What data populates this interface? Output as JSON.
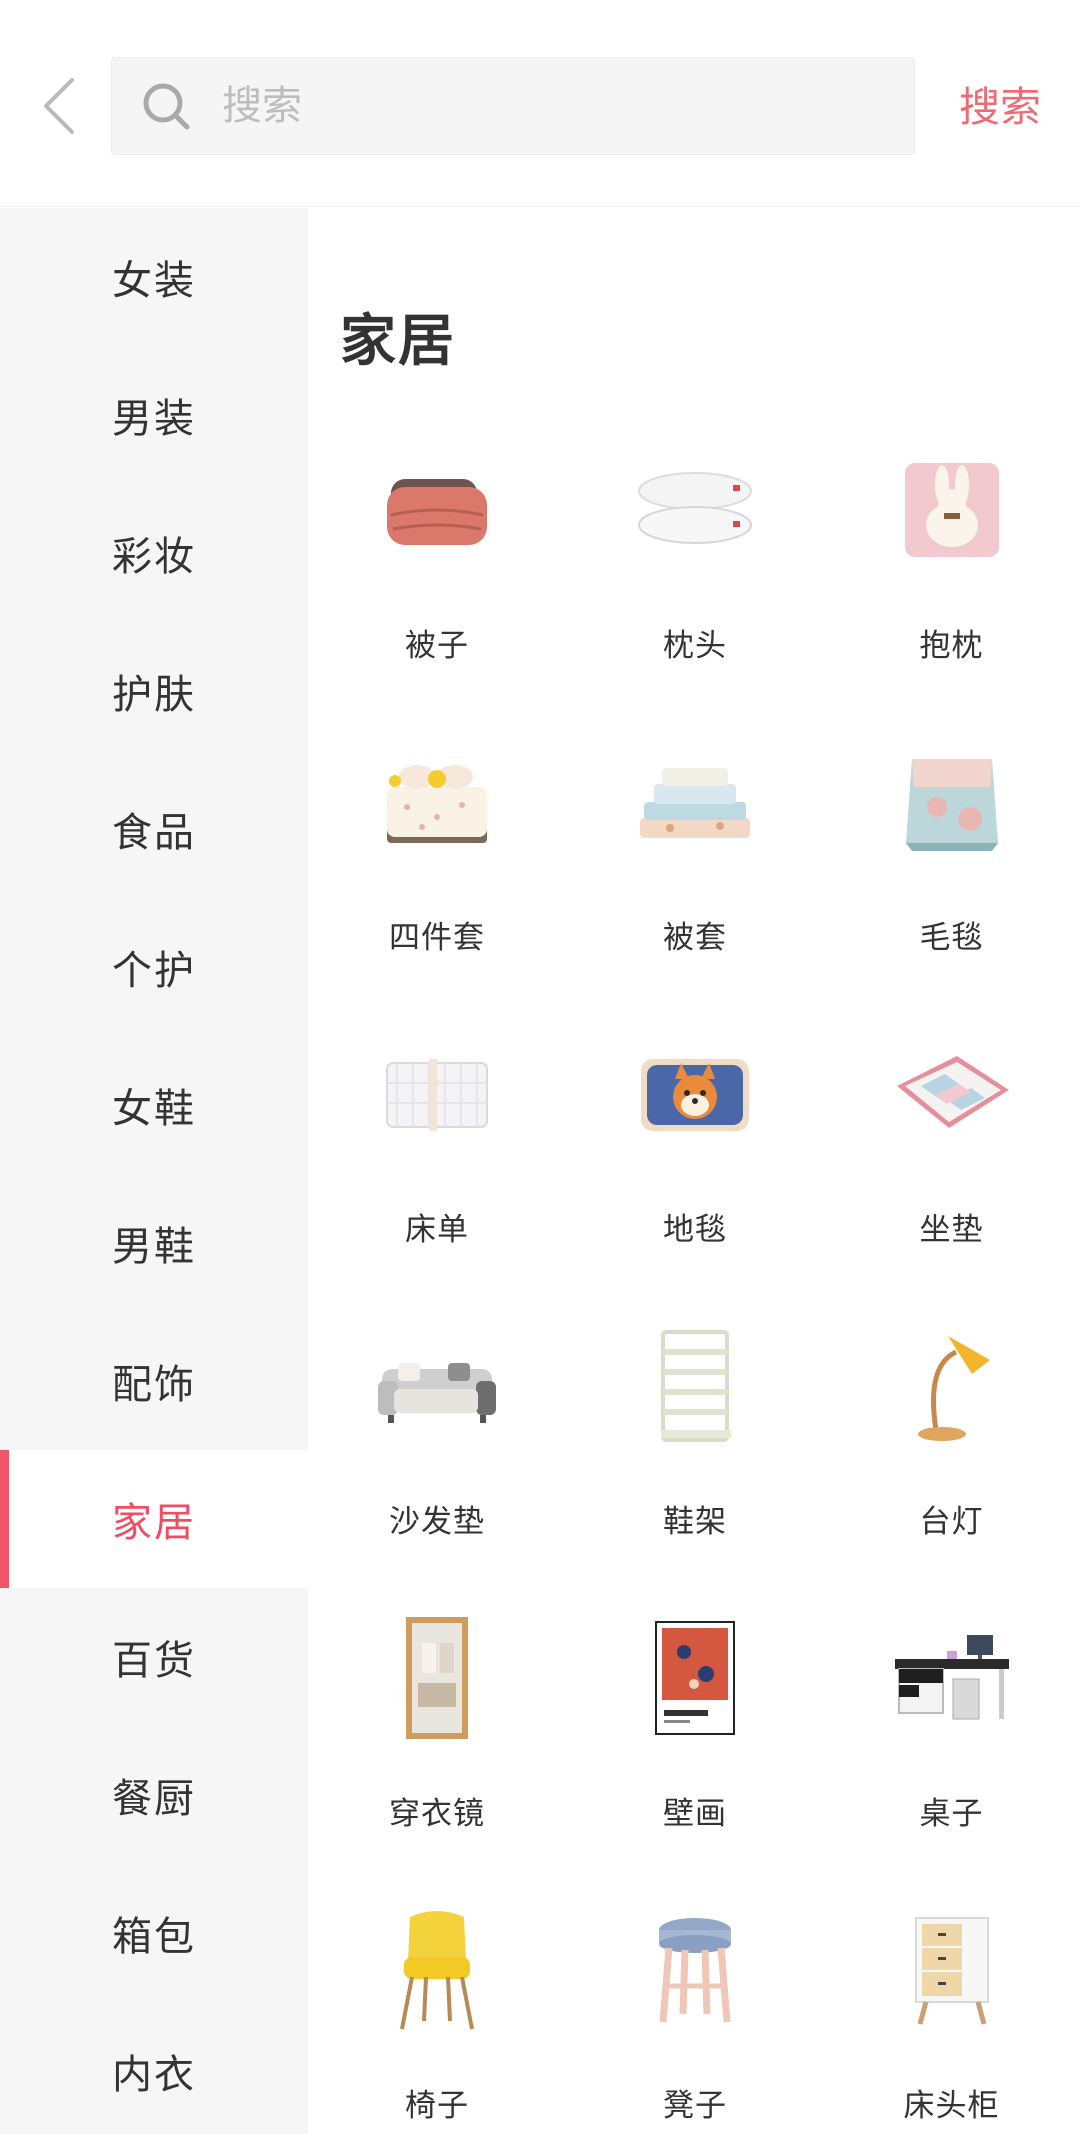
{
  "search": {
    "placeholder": "搜索",
    "button_label": "搜索"
  },
  "sidebar": {
    "active_index": 9,
    "items": [
      {
        "label": "女装"
      },
      {
        "label": "男装"
      },
      {
        "label": "彩妆"
      },
      {
        "label": "护肤"
      },
      {
        "label": "食品"
      },
      {
        "label": "个护"
      },
      {
        "label": "女鞋"
      },
      {
        "label": "男鞋"
      },
      {
        "label": "配饰"
      },
      {
        "label": "家居"
      },
      {
        "label": "百货"
      },
      {
        "label": "餐厨"
      },
      {
        "label": "箱包"
      },
      {
        "label": "内衣"
      }
    ]
  },
  "main": {
    "title": "家居",
    "items": [
      {
        "label": "被子",
        "icon": "quilt-icon"
      },
      {
        "label": "枕头",
        "icon": "pillow-icon"
      },
      {
        "label": "抱枕",
        "icon": "cushion-icon"
      },
      {
        "label": "四件套",
        "icon": "bedding-set-icon"
      },
      {
        "label": "被套",
        "icon": "duvet-cover-icon"
      },
      {
        "label": "毛毯",
        "icon": "blanket-icon"
      },
      {
        "label": "床单",
        "icon": "bed-sheet-icon"
      },
      {
        "label": "地毯",
        "icon": "rug-icon"
      },
      {
        "label": "坐垫",
        "icon": "seat-cushion-icon"
      },
      {
        "label": "沙发垫",
        "icon": "sofa-cover-icon"
      },
      {
        "label": "鞋架",
        "icon": "shoe-rack-icon"
      },
      {
        "label": "台灯",
        "icon": "desk-lamp-icon"
      },
      {
        "label": "穿衣镜",
        "icon": "mirror-icon"
      },
      {
        "label": "壁画",
        "icon": "wall-painting-icon"
      },
      {
        "label": "桌子",
        "icon": "desk-icon"
      },
      {
        "label": "椅子",
        "icon": "chair-icon"
      },
      {
        "label": "凳子",
        "icon": "stool-icon"
      },
      {
        "label": "床头柜",
        "icon": "nightstand-icon"
      }
    ]
  },
  "colors": {
    "accent": "#ee4d63",
    "search_button": "#ef6b73",
    "sidebar_bg": "#f6f6f6"
  }
}
